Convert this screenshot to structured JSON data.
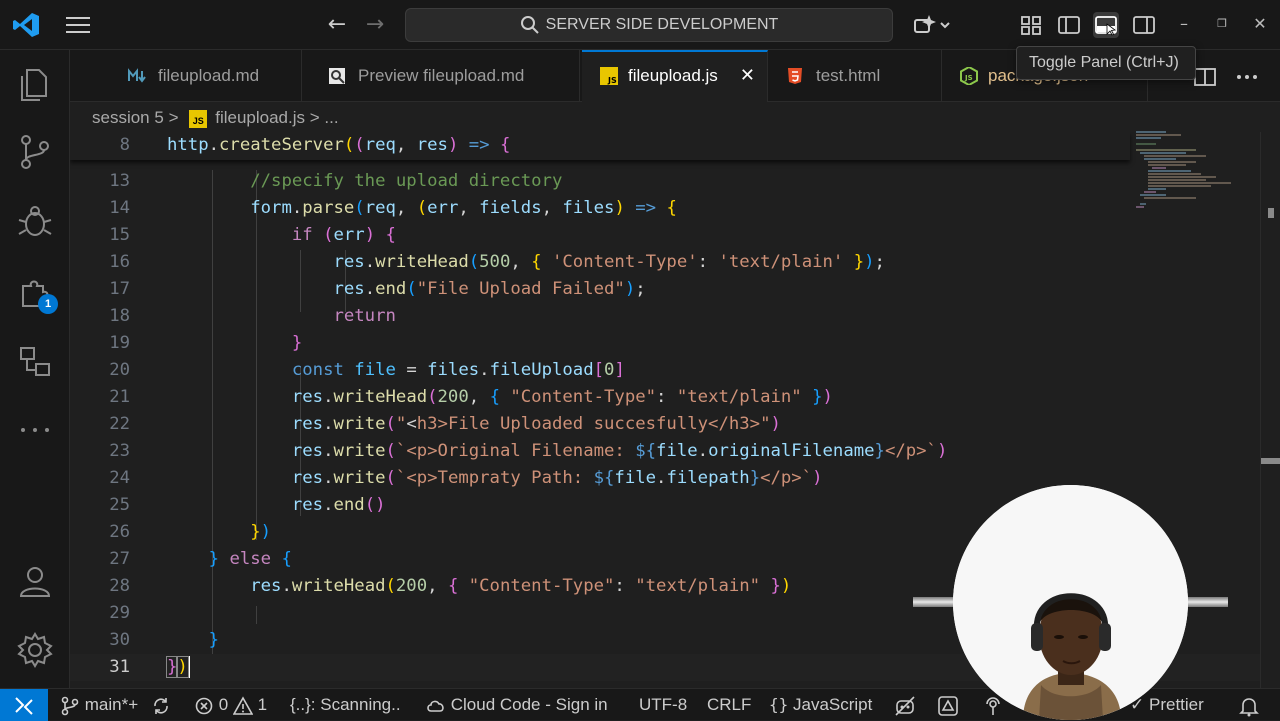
{
  "titlebar": {
    "search_text": "SERVER SIDE DEVELOPMENT",
    "tooltip": "Toggle Panel (Ctrl+J)"
  },
  "activity": {
    "extensions_badge": "1"
  },
  "tabs": [
    {
      "label": "fileupload.md",
      "icon": "markdown-icon",
      "active": false
    },
    {
      "label": "Preview fileupload.md",
      "icon": "preview-icon",
      "active": false
    },
    {
      "label": "fileupload.js",
      "icon": "js-file-icon",
      "active": true
    },
    {
      "label": "test.html",
      "icon": "html-file-icon",
      "active": false
    },
    {
      "label": "package.json",
      "icon": "node-file-icon",
      "active": false
    }
  ],
  "breadcrumb": {
    "folder": "session 5",
    "sep": ">",
    "file": "fileupload.js",
    "tail": "> ..."
  },
  "editor": {
    "sticky_line_number": "8",
    "sticky_code": "http.createServer((req, res) => {",
    "lines": [
      {
        "n": "13",
        "code": "        //specify the upload directory"
      },
      {
        "n": "14",
        "code": "        form.parse(req, (err, fields, files) => {"
      },
      {
        "n": "15",
        "code": "            if (err) {"
      },
      {
        "n": "16",
        "code": "                res.writeHead(500, { 'Content-Type': 'text/plain' });"
      },
      {
        "n": "17",
        "code": "                res.end(\"File Upload Failed\");"
      },
      {
        "n": "18",
        "code": "                return"
      },
      {
        "n": "19",
        "code": "            }"
      },
      {
        "n": "20",
        "code": "            const file = files.fileUpload[0]"
      },
      {
        "n": "21",
        "code": "            res.writeHead(200, { \"Content-Type\": \"text/plain\" })"
      },
      {
        "n": "22",
        "code": "            res.write(\"<h3>File Uploaded succesfully</h3>\")"
      },
      {
        "n": "23",
        "code": "            res.write(`<p>Original Filename: ${file.originalFilename}</p>`)"
      },
      {
        "n": "24",
        "code": "            res.write(`<p>Tempraty Path: ${file.filepath}</p>`)"
      },
      {
        "n": "25",
        "code": "            res.end()"
      },
      {
        "n": "26",
        "code": "        })"
      },
      {
        "n": "27",
        "code": "    } else {"
      },
      {
        "n": "28",
        "code": "        res.writeHead(200, { \"Content-Type\": \"text/plain\" })"
      },
      {
        "n": "29",
        "code": ""
      },
      {
        "n": "30",
        "code": "    }"
      },
      {
        "n": "31",
        "code": "})"
      }
    ]
  },
  "statusbar": {
    "branch": "main*+",
    "errors": "0",
    "warnings": "1",
    "scanning": "{..}: Scanning..",
    "cloud_code": "Cloud Code - Sign in",
    "encoding": "UTF-8",
    "eol": "CRLF",
    "language": "JavaScript",
    "prettier": "Prettier"
  },
  "colors": {
    "accent": "#0078d4",
    "background": "#1f1f1f",
    "chrome": "#181818"
  }
}
